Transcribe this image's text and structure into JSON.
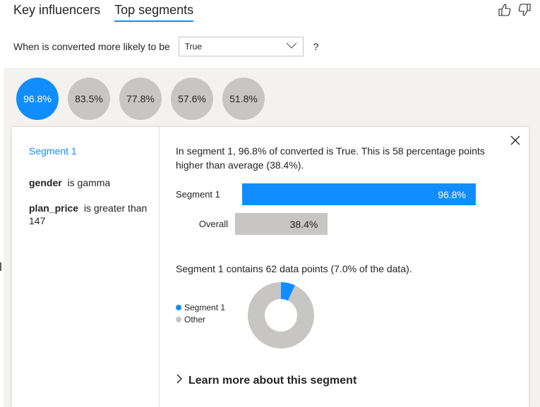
{
  "tabs": [
    {
      "label": "Key influencers",
      "active": false
    },
    {
      "label": "Top segments",
      "active": true
    }
  ],
  "feedback": {
    "thumbs_up": "thumbs-up-icon",
    "thumbs_down": "thumbs-down-icon"
  },
  "question": {
    "prefix": "When is converted more likely to be",
    "selected": "True",
    "suffix": "?"
  },
  "segments": [
    "96.8%",
    "83.5%",
    "77.8%",
    "57.6%",
    "51.8%"
  ],
  "detail": {
    "segment_title": "Segment 1",
    "conditions": [
      {
        "field": "gender",
        "text": "is gamma"
      },
      {
        "field": "plan_price",
        "text": "is greater than 147"
      }
    ],
    "description": "In segment 1, 96.8% of converted is True. This is 58 percentage points higher than average (38.4%).",
    "contains": "Segment 1 contains 62 data points (7.0% of the data).",
    "learn_more": "Learn more about this segment"
  },
  "chart_data": [
    {
      "type": "bar",
      "categories": [
        "Segment 1",
        "Overall"
      ],
      "values": [
        96.8,
        38.4
      ],
      "value_labels": [
        "96.8%",
        "38.4%"
      ],
      "colors": [
        "#118dff",
        "#c8c6c4"
      ]
    },
    {
      "type": "pie",
      "categories": [
        "Segment 1",
        "Other"
      ],
      "values": [
        7.0,
        93.0
      ],
      "colors": [
        "#118dff",
        "#c8c6c4"
      ],
      "legend": "left"
    }
  ],
  "colors": {
    "accent": "#118dff",
    "neutral": "#c8c6c4",
    "background": "#f3f2f1"
  }
}
